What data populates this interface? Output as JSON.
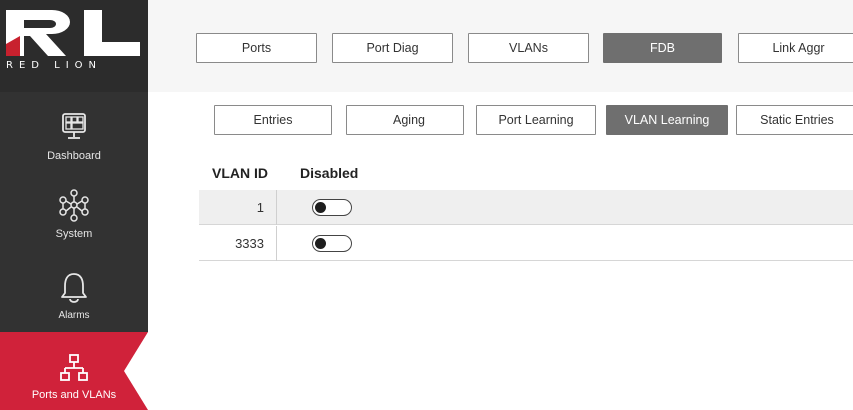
{
  "brand": {
    "logo_letters": "RL",
    "name": "RED LION"
  },
  "sidebar": {
    "items": [
      {
        "label": "Dashboard",
        "icon": "dashboard-icon"
      },
      {
        "label": "System",
        "icon": "network-graph-icon"
      },
      {
        "label": "Alarms",
        "icon": "bell-icon"
      },
      {
        "label": "Ports and VLANs",
        "icon": "network-topology-icon",
        "active": true
      }
    ]
  },
  "main_tabs": [
    {
      "label": "Ports"
    },
    {
      "label": "Port Diag"
    },
    {
      "label": "VLANs"
    },
    {
      "label": "FDB",
      "active": true
    },
    {
      "label": "Link Aggr"
    }
  ],
  "sub_tabs": [
    {
      "label": "Entries"
    },
    {
      "label": "Aging"
    },
    {
      "label": "Port Learning"
    },
    {
      "label": "VLAN Learning",
      "active": true
    },
    {
      "label": "Static Entries"
    }
  ],
  "table": {
    "headers": {
      "vlan_id": "VLAN ID",
      "disabled": "Disabled"
    },
    "rows": [
      {
        "vlan_id": "1",
        "disabled": false
      },
      {
        "vlan_id": "3333",
        "disabled": false
      }
    ]
  },
  "colors": {
    "sidebar_bg": "#323232",
    "active_nav": "#d0223a",
    "active_tab": "#6f6f6f",
    "logo_red": "#c8212e"
  }
}
